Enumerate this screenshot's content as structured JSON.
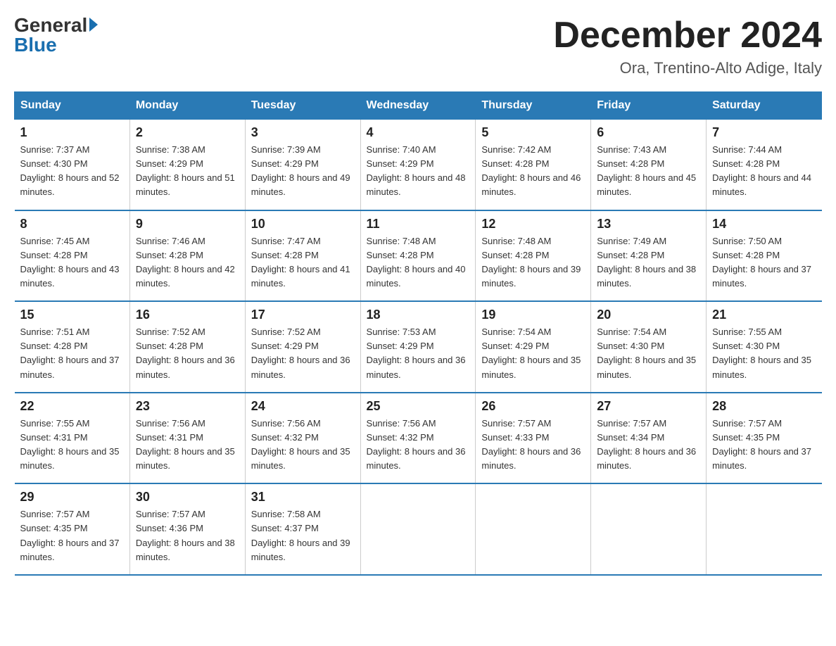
{
  "header": {
    "logo_general": "General",
    "logo_blue": "Blue",
    "month_year": "December 2024",
    "location": "Ora, Trentino-Alto Adige, Italy"
  },
  "days_of_week": [
    "Sunday",
    "Monday",
    "Tuesday",
    "Wednesday",
    "Thursday",
    "Friday",
    "Saturday"
  ],
  "weeks": [
    [
      {
        "day": 1,
        "sunrise": "7:37 AM",
        "sunset": "4:30 PM",
        "daylight": "8 hours and 52 minutes."
      },
      {
        "day": 2,
        "sunrise": "7:38 AM",
        "sunset": "4:29 PM",
        "daylight": "8 hours and 51 minutes."
      },
      {
        "day": 3,
        "sunrise": "7:39 AM",
        "sunset": "4:29 PM",
        "daylight": "8 hours and 49 minutes."
      },
      {
        "day": 4,
        "sunrise": "7:40 AM",
        "sunset": "4:29 PM",
        "daylight": "8 hours and 48 minutes."
      },
      {
        "day": 5,
        "sunrise": "7:42 AM",
        "sunset": "4:28 PM",
        "daylight": "8 hours and 46 minutes."
      },
      {
        "day": 6,
        "sunrise": "7:43 AM",
        "sunset": "4:28 PM",
        "daylight": "8 hours and 45 minutes."
      },
      {
        "day": 7,
        "sunrise": "7:44 AM",
        "sunset": "4:28 PM",
        "daylight": "8 hours and 44 minutes."
      }
    ],
    [
      {
        "day": 8,
        "sunrise": "7:45 AM",
        "sunset": "4:28 PM",
        "daylight": "8 hours and 43 minutes."
      },
      {
        "day": 9,
        "sunrise": "7:46 AM",
        "sunset": "4:28 PM",
        "daylight": "8 hours and 42 minutes."
      },
      {
        "day": 10,
        "sunrise": "7:47 AM",
        "sunset": "4:28 PM",
        "daylight": "8 hours and 41 minutes."
      },
      {
        "day": 11,
        "sunrise": "7:48 AM",
        "sunset": "4:28 PM",
        "daylight": "8 hours and 40 minutes."
      },
      {
        "day": 12,
        "sunrise": "7:48 AM",
        "sunset": "4:28 PM",
        "daylight": "8 hours and 39 minutes."
      },
      {
        "day": 13,
        "sunrise": "7:49 AM",
        "sunset": "4:28 PM",
        "daylight": "8 hours and 38 minutes."
      },
      {
        "day": 14,
        "sunrise": "7:50 AM",
        "sunset": "4:28 PM",
        "daylight": "8 hours and 37 minutes."
      }
    ],
    [
      {
        "day": 15,
        "sunrise": "7:51 AM",
        "sunset": "4:28 PM",
        "daylight": "8 hours and 37 minutes."
      },
      {
        "day": 16,
        "sunrise": "7:52 AM",
        "sunset": "4:28 PM",
        "daylight": "8 hours and 36 minutes."
      },
      {
        "day": 17,
        "sunrise": "7:52 AM",
        "sunset": "4:29 PM",
        "daylight": "8 hours and 36 minutes."
      },
      {
        "day": 18,
        "sunrise": "7:53 AM",
        "sunset": "4:29 PM",
        "daylight": "8 hours and 36 minutes."
      },
      {
        "day": 19,
        "sunrise": "7:54 AM",
        "sunset": "4:29 PM",
        "daylight": "8 hours and 35 minutes."
      },
      {
        "day": 20,
        "sunrise": "7:54 AM",
        "sunset": "4:30 PM",
        "daylight": "8 hours and 35 minutes."
      },
      {
        "day": 21,
        "sunrise": "7:55 AM",
        "sunset": "4:30 PM",
        "daylight": "8 hours and 35 minutes."
      }
    ],
    [
      {
        "day": 22,
        "sunrise": "7:55 AM",
        "sunset": "4:31 PM",
        "daylight": "8 hours and 35 minutes."
      },
      {
        "day": 23,
        "sunrise": "7:56 AM",
        "sunset": "4:31 PM",
        "daylight": "8 hours and 35 minutes."
      },
      {
        "day": 24,
        "sunrise": "7:56 AM",
        "sunset": "4:32 PM",
        "daylight": "8 hours and 35 minutes."
      },
      {
        "day": 25,
        "sunrise": "7:56 AM",
        "sunset": "4:32 PM",
        "daylight": "8 hours and 36 minutes."
      },
      {
        "day": 26,
        "sunrise": "7:57 AM",
        "sunset": "4:33 PM",
        "daylight": "8 hours and 36 minutes."
      },
      {
        "day": 27,
        "sunrise": "7:57 AM",
        "sunset": "4:34 PM",
        "daylight": "8 hours and 36 minutes."
      },
      {
        "day": 28,
        "sunrise": "7:57 AM",
        "sunset": "4:35 PM",
        "daylight": "8 hours and 37 minutes."
      }
    ],
    [
      {
        "day": 29,
        "sunrise": "7:57 AM",
        "sunset": "4:35 PM",
        "daylight": "8 hours and 37 minutes."
      },
      {
        "day": 30,
        "sunrise": "7:57 AM",
        "sunset": "4:36 PM",
        "daylight": "8 hours and 38 minutes."
      },
      {
        "day": 31,
        "sunrise": "7:58 AM",
        "sunset": "4:37 PM",
        "daylight": "8 hours and 39 minutes."
      },
      null,
      null,
      null,
      null
    ]
  ]
}
